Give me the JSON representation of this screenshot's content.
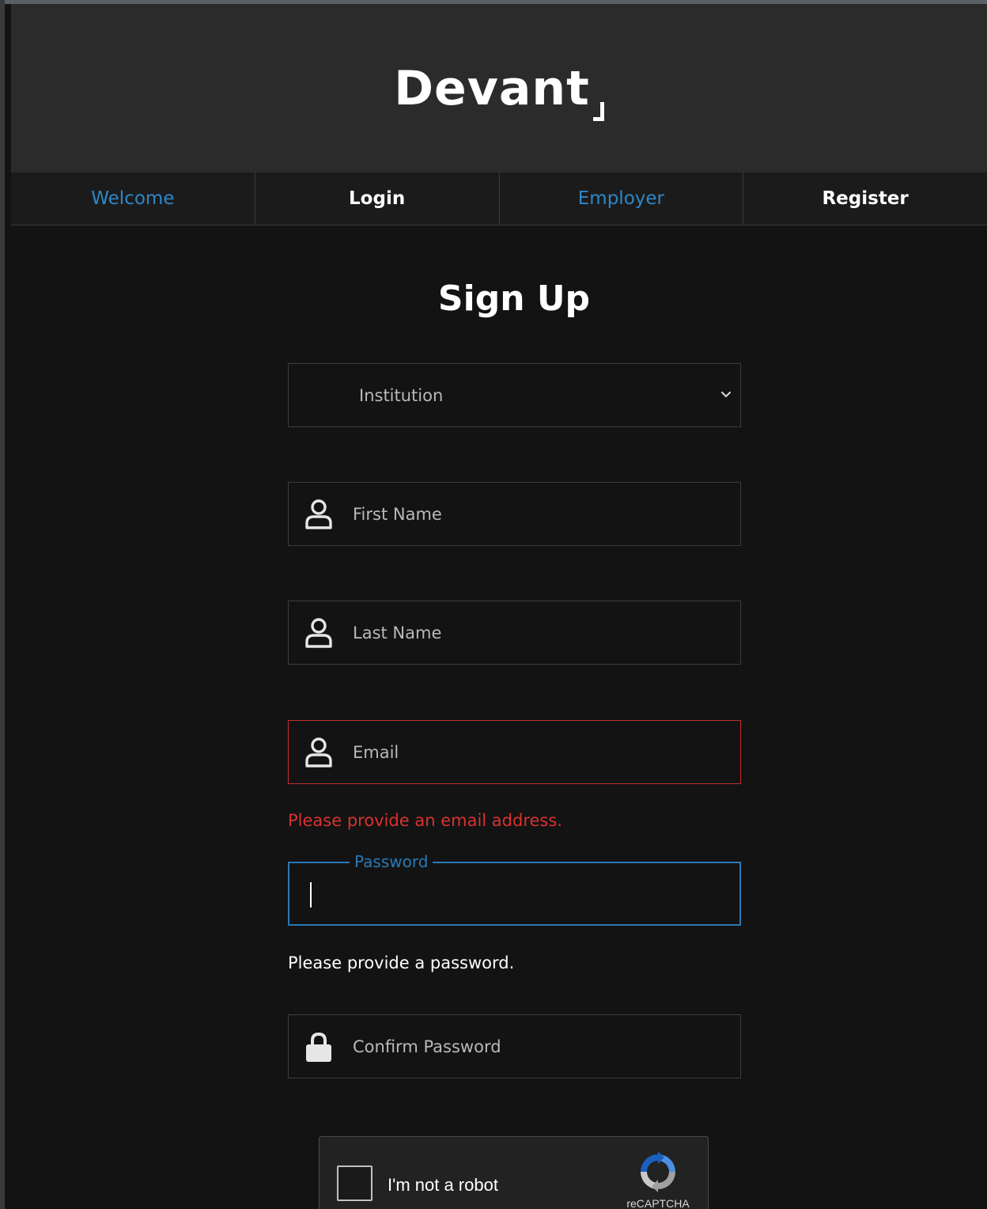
{
  "header": {
    "logo_text": "Devant"
  },
  "nav": {
    "tabs": [
      {
        "label": "Welcome"
      },
      {
        "label": "Login"
      },
      {
        "label": "Employer"
      },
      {
        "label": "Register"
      }
    ]
  },
  "form": {
    "title": "Sign Up",
    "institution_select": {
      "value": "Institution",
      "icon": "chevron-down-icon"
    },
    "first_name": {
      "placeholder": "First Name",
      "icon": "user-icon"
    },
    "last_name": {
      "placeholder": "Last Name",
      "icon": "user-icon"
    },
    "email": {
      "placeholder": "Email",
      "icon": "user-icon",
      "error": "Please provide an email address."
    },
    "password": {
      "label": "Password",
      "value": "",
      "hint": "Please provide a password."
    },
    "confirm_password": {
      "placeholder": "Confirm Password",
      "icon": "lock-icon"
    }
  },
  "captcha": {
    "label": "I'm not a robot",
    "brand": "reCAPTCHA"
  },
  "colors": {
    "link": "#2e87c8",
    "error": "#d8322f",
    "focus": "#2b79b4",
    "background": "#131313",
    "header": "#2b2b2b"
  }
}
